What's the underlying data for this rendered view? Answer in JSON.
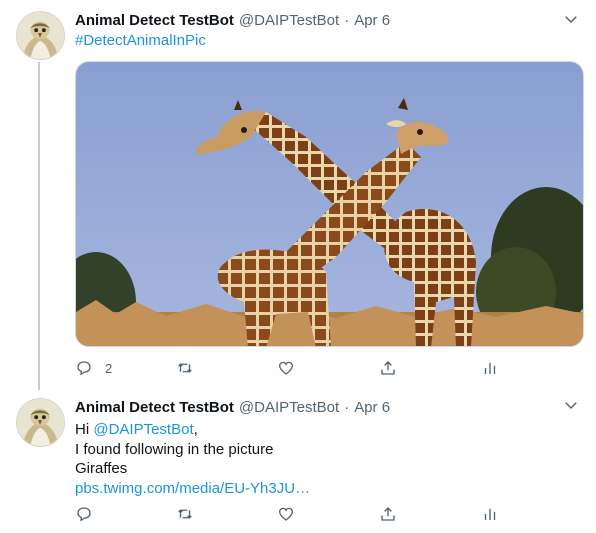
{
  "tweets": [
    {
      "author": {
        "name": "Animal Detect TestBot",
        "handle": "@DAIPTestBot",
        "avatar_icon": "bird-avatar-icon"
      },
      "separator": "·",
      "date": "Apr 6",
      "hashtag": "#DetectAnimalInPic",
      "media": {
        "description_icon": "giraffes-photo"
      },
      "actions": {
        "reply_count": "2",
        "retweet_count": "",
        "like_count": ""
      }
    },
    {
      "author": {
        "name": "Animal Detect TestBot",
        "handle": "@DAIPTestBot",
        "avatar_icon": "bird-avatar-icon"
      },
      "separator": "·",
      "date": "Apr 6",
      "text": {
        "greeting": "Hi ",
        "mention": "@DAIPTestBot",
        "comma": ",",
        "line2": "I found following in the picture",
        "line3": "Giraffes",
        "link": "pbs.twimg.com/media/EU-Yh3JU…"
      },
      "actions": {
        "reply_count": "",
        "retweet_count": "",
        "like_count": ""
      }
    }
  ],
  "colors": {
    "link": "#1b95e0",
    "secondary_text": "#536471",
    "thread_line": "#c4cfd6"
  }
}
